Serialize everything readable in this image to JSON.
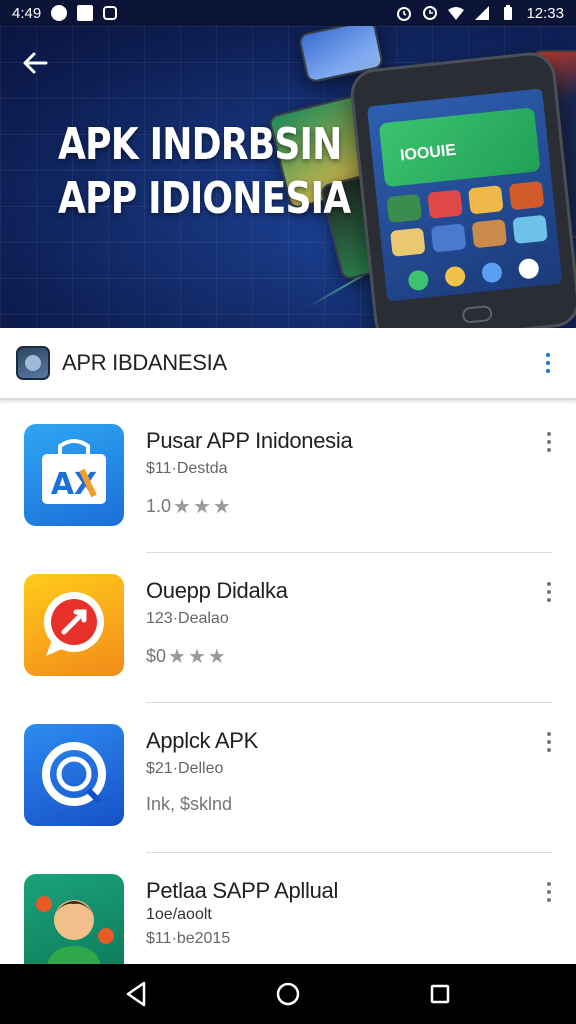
{
  "status_bar": {
    "time_left": "4:49",
    "time_right": "12:33"
  },
  "hero": {
    "title_line1": "APK INDRBSIN",
    "title_line2": "APP IDIONESIA",
    "phone_banner_text": "IOOUIE"
  },
  "app_bar": {
    "title": "APR IBDANESIA"
  },
  "apps": [
    {
      "title": "Pusar APP Inidonesia",
      "subtitle": "$11·Destda",
      "rating": "1.0"
    },
    {
      "title": "Ouepp Didalka",
      "subtitle": "123·Dealao",
      "rating": "$0"
    },
    {
      "title": "Applck APK",
      "subtitle": "$21·Delleo",
      "rating": "Ink, $sklnd"
    },
    {
      "title": "Petlaa SAPP Apllual",
      "subtitle_top": "1oe/aoolt",
      "subtitle": "$11·be2015",
      "rating": ""
    }
  ],
  "icons": {
    "back": "arrow-left-icon",
    "overflow": "more-vert-icon",
    "nav_back": "triangle-back-icon",
    "nav_home": "circle-home-icon",
    "nav_recents": "square-recents-icon"
  },
  "colors": {
    "accent": "#1a73e8",
    "hero_bg": "#163277"
  }
}
